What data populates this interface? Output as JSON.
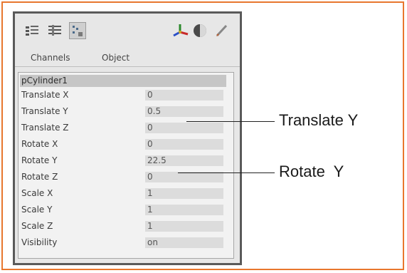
{
  "tabs": [
    "Channels",
    "Object"
  ],
  "object_name": "pCylinder1",
  "channels": [
    {
      "label": "Translate X",
      "value": "0"
    },
    {
      "label": "Translate Y",
      "value": "0.5"
    },
    {
      "label": "Translate Z",
      "value": "0"
    },
    {
      "label": "Rotate X",
      "value": "0"
    },
    {
      "label": "Rotate Y",
      "value": "22.5"
    },
    {
      "label": "Rotate Z",
      "value": "0"
    },
    {
      "label": "Scale X",
      "value": "1"
    },
    {
      "label": "Scale Y",
      "value": "1"
    },
    {
      "label": "Scale Z",
      "value": "1"
    },
    {
      "label": "Visibility",
      "value": "on"
    }
  ],
  "callouts": {
    "translate_y": "Translate Y",
    "rotate_y": "Rotate  Y"
  },
  "colors": {
    "frame_border": "#e8772e",
    "panel_border": "#5a5a5a",
    "object_row": "#c6c6c6"
  },
  "icons": [
    "channel-box-icon",
    "layer-editor-icon",
    "attribute-editor-icon",
    "axis-manipulator-icon",
    "shading-sphere-icon",
    "pen-tool-icon"
  ]
}
